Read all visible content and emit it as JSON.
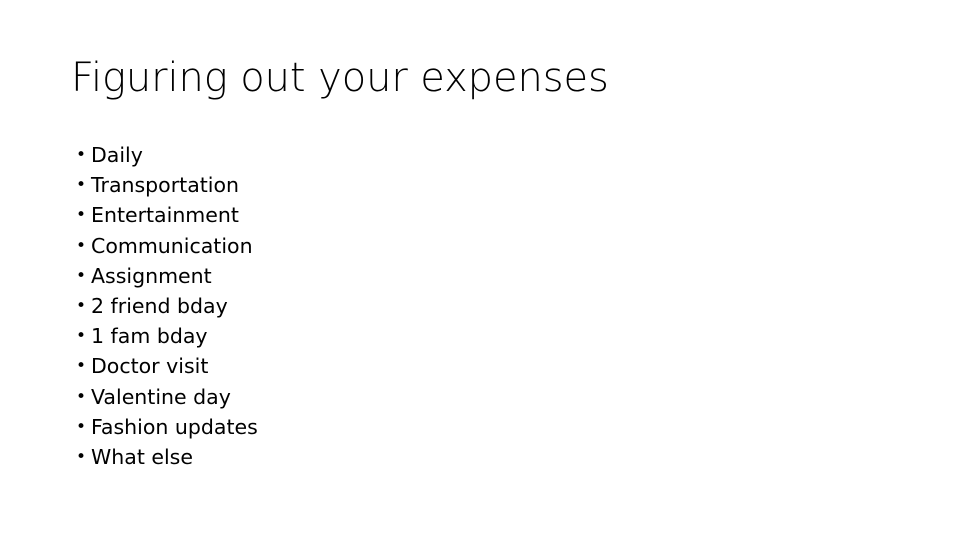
{
  "slide": {
    "title": "Figuring out your expenses",
    "background_color": "#ffffff",
    "text_color": "#000000",
    "bullet_glyph": "•",
    "bullets": [
      {
        "label": "Daily"
      },
      {
        "label": "Transportation"
      },
      {
        "label": "Entertainment"
      },
      {
        "label": "Communication"
      },
      {
        "label": "Assignment"
      },
      {
        "label": "2 friend bday"
      },
      {
        "label": "1 fam bday"
      },
      {
        "label": "Doctor visit"
      },
      {
        "label": "Valentine day"
      },
      {
        "label": "Fashion updates"
      },
      {
        "label": "What else"
      }
    ]
  }
}
